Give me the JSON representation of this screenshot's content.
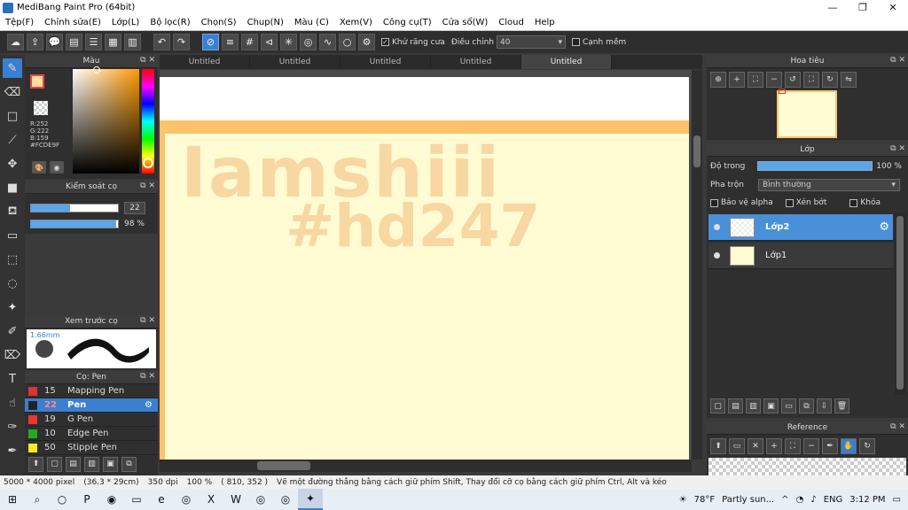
{
  "window": {
    "title": "MediBang Paint Pro (64bit)",
    "minimize": "—",
    "maximize": "❐",
    "close": "✕"
  },
  "menu": [
    "Tệp(F)",
    "Chỉnh sửa(E)",
    "Lớp(L)",
    "Bộ lọc(R)",
    "Chọn(S)",
    "Chup(N)",
    "Màu (C)",
    "Xem(V)",
    "Công cụ(T)",
    "Cửa sổ(W)",
    "Cloud",
    "Help"
  ],
  "toolbar": {
    "antialias_label": "Khử răng cưa",
    "adjust_label": "Điều chỉnh",
    "adjust_value": "40",
    "soft_edge_label": "Cạnh mềm"
  },
  "panels": {
    "color": {
      "title": "Màu",
      "r": "R:252",
      "g": "G:222",
      "b": "B:159",
      "hex": "#FCDE9F",
      "fg_color": "#FCDE9F"
    },
    "brush_control": {
      "title": "Kiểm soát cọ",
      "size_value": "22",
      "size_fraction": 0.45,
      "opacity_value": "98 %",
      "opacity_fraction": 0.98
    },
    "preview": {
      "title": "Xem trước cọ",
      "size_label": "1.66mm"
    },
    "brush_list": {
      "title": "Cọ: Pen",
      "items": [
        {
          "num": "15",
          "name": "Mapping Pen",
          "color": "#d33"
        },
        {
          "num": "22",
          "name": "Pen",
          "color": "#222"
        },
        {
          "num": "19",
          "name": "G Pen",
          "color": "#e33"
        },
        {
          "num": "10",
          "name": "Edge Pen",
          "color": "#2a2"
        },
        {
          "num": "50",
          "name": "Stipple Pen",
          "color": "#ee2"
        }
      ]
    }
  },
  "doc_tabs": [
    "Untitled",
    "Untitled",
    "Untitled",
    "Untitled",
    "Untitled"
  ],
  "canvas": {
    "line1": "Iamshiii",
    "line2": "#hd247"
  },
  "navigator": {
    "title": "Hoa tiêu"
  },
  "layers": {
    "title": "Lớp",
    "opacity_label": "Độ trong",
    "opacity_value": "100 %",
    "blend_label": "Pha trộn",
    "blend_value": "Bình thường",
    "protect_alpha": "Bảo vệ alpha",
    "clipping": "Xén bớt",
    "lock": "Khóa",
    "items": [
      {
        "name": "Lớp2",
        "active": true
      },
      {
        "name": "Lớp1",
        "active": false
      }
    ]
  },
  "reference": {
    "title": "Reference"
  },
  "status": {
    "dimensions": "5000 * 4000 pixel",
    "physical": "(36.3 * 29cm)",
    "dpi": "350 dpi",
    "zoom": "100 %",
    "coords": "( 810, 352 )",
    "hint": "Vẽ một đường thẳng bằng cách giữ phím Shift, Thay đổi cỡ cọ bằng cách giữ phím Ctrl, Alt và kéo"
  },
  "taskbar": {
    "weather_temp": "78°F",
    "weather_desc": "Partly sun...",
    "lang": "ENG",
    "time": "3:12 PM"
  }
}
